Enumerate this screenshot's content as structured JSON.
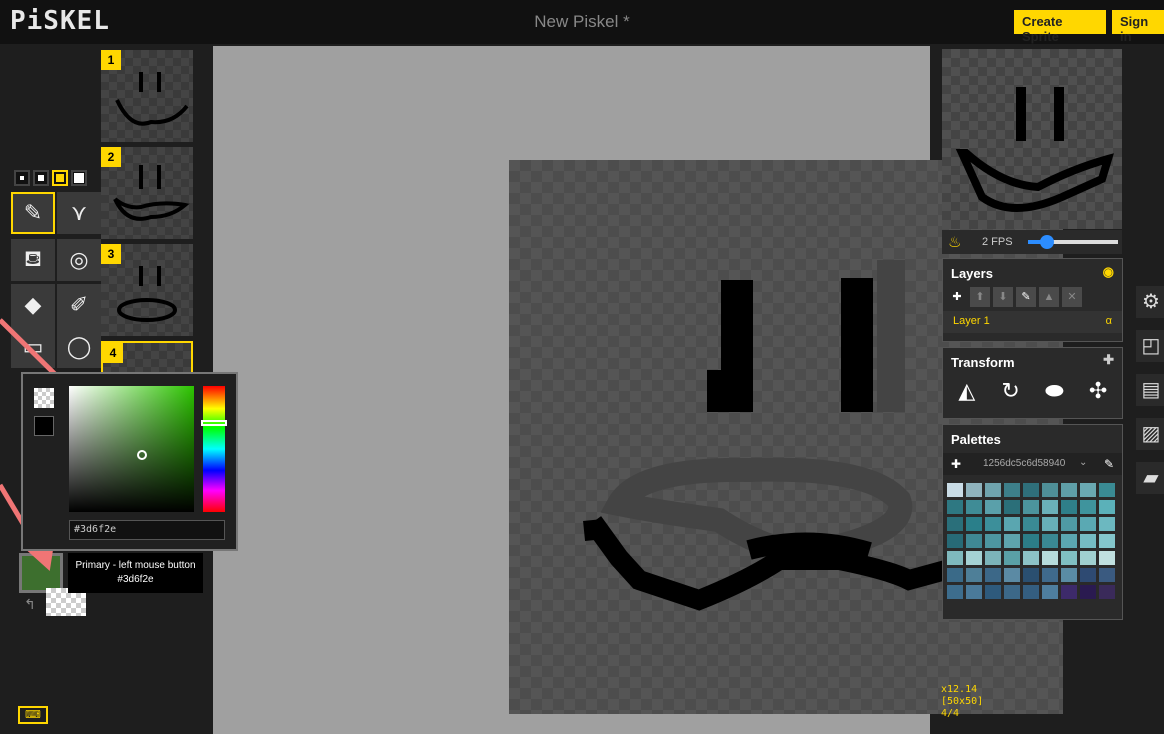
{
  "app": {
    "logo": "PiSKEL",
    "title": "New Piskel *"
  },
  "header": {
    "create_label": "Create Sprite",
    "signin_label": "Sign in"
  },
  "frames": [
    {
      "number": "1"
    },
    {
      "number": "2"
    },
    {
      "number": "3"
    },
    {
      "number": "4"
    }
  ],
  "preview": {
    "fps_label": "2 FPS",
    "fps_value": 2
  },
  "layers": {
    "title": "Layers",
    "items": [
      {
        "name": "Layer 1",
        "opacity_symbol": "α"
      }
    ]
  },
  "transform": {
    "title": "Transform"
  },
  "palettes": {
    "title": "Palettes",
    "selected": "1256dc5c6d58940"
  },
  "color_picker": {
    "hex_value": "#3d6f2e",
    "tooltip_line1": "Primary - left mouse button",
    "tooltip_line2": "#3d6f2e"
  },
  "colors": {
    "primary": "#3d6f2e",
    "accent": "#ffd700"
  },
  "status": {
    "zoom": "x12.14",
    "size": "[50x50]",
    "frame": "4/4"
  },
  "icons": [
    "pen-icon",
    "vertical-mirror-pen-icon",
    "paint-bucket-icon",
    "same-color-fill-icon",
    "eraser-icon",
    "stroke-icon",
    "rectangle-icon",
    "ellipse-icon",
    "onion-skin-icon",
    "eye-icon",
    "gear-icon",
    "resize-icon",
    "save-icon",
    "export-icon",
    "folder-icon",
    "keyboard-icon"
  ]
}
